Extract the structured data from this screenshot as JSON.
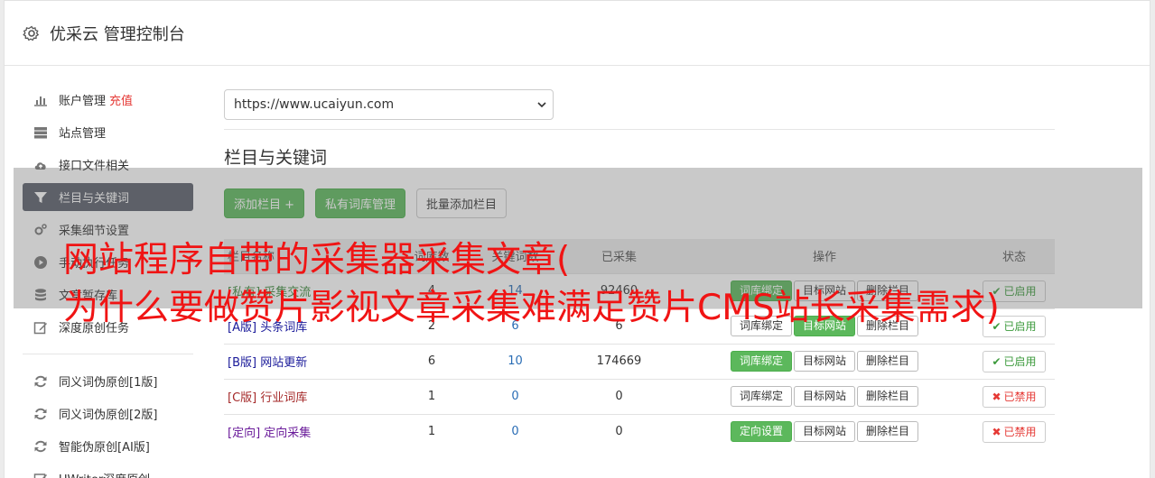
{
  "header": {
    "title": "优采云 管理控制台"
  },
  "sidebar": {
    "items": [
      {
        "label": "账户管理",
        "extra": "充值"
      },
      {
        "label": "站点管理"
      },
      {
        "label": "接口文件相关"
      },
      {
        "label": "栏目与关键词"
      },
      {
        "label": "采集细节设置"
      },
      {
        "label": "手动执行任务"
      },
      {
        "label": "文章暂存库"
      },
      {
        "label": "深度原创任务"
      }
    ],
    "tools": [
      {
        "label": "同义词伪原创[1版]"
      },
      {
        "label": "同义词伪原创[2版]"
      },
      {
        "label": "智能伪原创[AI版]"
      },
      {
        "label": "UWriter深度原创"
      }
    ]
  },
  "main": {
    "site_select": "https://www.ucaiyun.com",
    "section_title": "栏目与关键词",
    "buttons": {
      "add": "添加栏目 +",
      "private_lib": "私有词库管理",
      "batch_add": "批量添加栏目"
    },
    "table": {
      "headers": [
        "栏目名称",
        "词库数",
        "关键词数",
        "已采集",
        "操作",
        "状态"
      ],
      "rows": [
        {
          "tag": "[私有]",
          "name": "采集交流",
          "a": "4",
          "b": "14",
          "c": "92460",
          "op1": "词库绑定",
          "op2": "目标网站",
          "op3": "删除栏目",
          "status": "已启用",
          "enabled": true,
          "op1_green": true,
          "op2_green": false,
          "color": "#3c8a3c"
        },
        {
          "tag": "[A版]",
          "name": "头条词库",
          "a": "2",
          "b": "6",
          "c": "6",
          "op1": "词库绑定",
          "op2": "目标网站",
          "op3": "删除栏目",
          "status": "已启用",
          "enabled": true,
          "op1_green": false,
          "op2_green": true,
          "color": "#1a1a9a"
        },
        {
          "tag": "[B版]",
          "name": "网站更新",
          "a": "6",
          "b": "10",
          "c": "174669",
          "op1": "词库绑定",
          "op2": "目标网站",
          "op3": "删除栏目",
          "status": "已启用",
          "enabled": true,
          "op1_green": true,
          "op2_green": false,
          "color": "#1a1a9a"
        },
        {
          "tag": "[C版]",
          "name": "行业词库",
          "a": "1",
          "b": "0",
          "c": "0",
          "op1": "词库绑定",
          "op2": "目标网站",
          "op3": "删除栏目",
          "status": "已禁用",
          "enabled": false,
          "op1_green": false,
          "op2_green": false,
          "color": "#a52a2a"
        },
        {
          "tag": "[定向]",
          "name": "定向采集",
          "a": "1",
          "b": "0",
          "c": "0",
          "op1": "定向设置",
          "op2": "目标网站",
          "op3": "删除栏目",
          "status": "已禁用",
          "enabled": false,
          "op1_green": true,
          "op2_green": false,
          "color": "#6a1b9a"
        }
      ]
    }
  },
  "overlay": {
    "line1": "网站程序自带的采集器采集文章(",
    "line2": "为什么要做赞片影视文章采集难满足赞片CMS站长采集需求)"
  },
  "colors": {
    "accent_green": "#5cb85c",
    "active_sidebar": "#5a5f6a",
    "overlay_red": "#f01414",
    "enabled_green": "#3c9a3c",
    "disabled_red": "#e53935"
  }
}
